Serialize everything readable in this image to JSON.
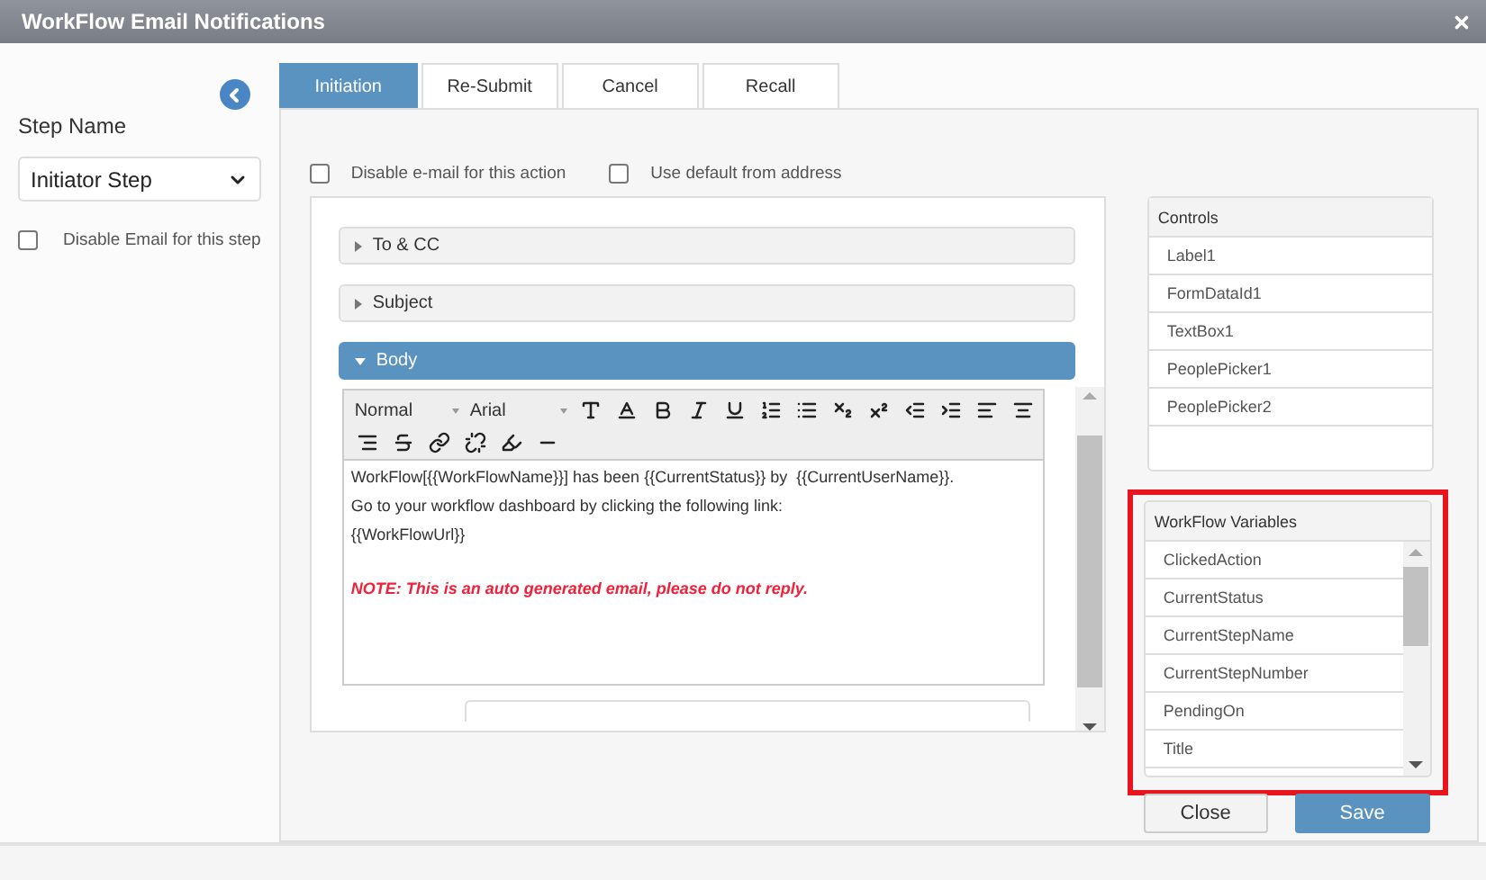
{
  "window": {
    "title": "WorkFlow Email Notifications"
  },
  "sidebar": {
    "label": "Step Name",
    "step": "Initiator Step",
    "disable": {
      "label": "Disable Email for this step",
      "checked": false
    }
  },
  "tabs": [
    {
      "label": "Initiation",
      "selected": true
    },
    {
      "label": "Re-Submit",
      "selected": false
    },
    {
      "label": "Cancel",
      "selected": false
    },
    {
      "label": "Recall",
      "selected": false
    }
  ],
  "options": [
    {
      "label": "Disable e-mail for this action",
      "checked": false
    },
    {
      "label": "Use default from address",
      "checked": false
    }
  ],
  "sections": [
    {
      "label": "To & CC",
      "expanded": false
    },
    {
      "label": "Subject",
      "expanded": false
    },
    {
      "label": "Body",
      "expanded": true
    }
  ],
  "editor": {
    "format": "Normal",
    "font": "Arial",
    "lines": [
      {
        "kind": "text",
        "text": "WorkFlow[{{WorkFlowName}}] has been {{CurrentStatus}} by  {{CurrentUserName}}."
      },
      {
        "kind": "text",
        "text": "Go to your workflow dashboard by clicking the following link:"
      },
      {
        "kind": "text",
        "text": "{{WorkFlowUrl}}"
      },
      {
        "kind": "note",
        "text": "NOTE: This is an auto generated email, please do not reply."
      }
    ]
  },
  "controls": {
    "title": "Controls",
    "items": [
      "Label1",
      "FormDataId1",
      "TextBox1",
      "PeoplePicker1",
      "PeoplePicker2"
    ]
  },
  "variables": {
    "title": "WorkFlow Variables",
    "items": [
      "ClickedAction",
      "CurrentStatus",
      "CurrentStepName",
      "CurrentStepNumber",
      "PendingOn",
      "Title"
    ]
  },
  "buttons": [
    {
      "label": "Close",
      "kind": "secondary"
    },
    {
      "label": "Save",
      "kind": "primary"
    }
  ]
}
